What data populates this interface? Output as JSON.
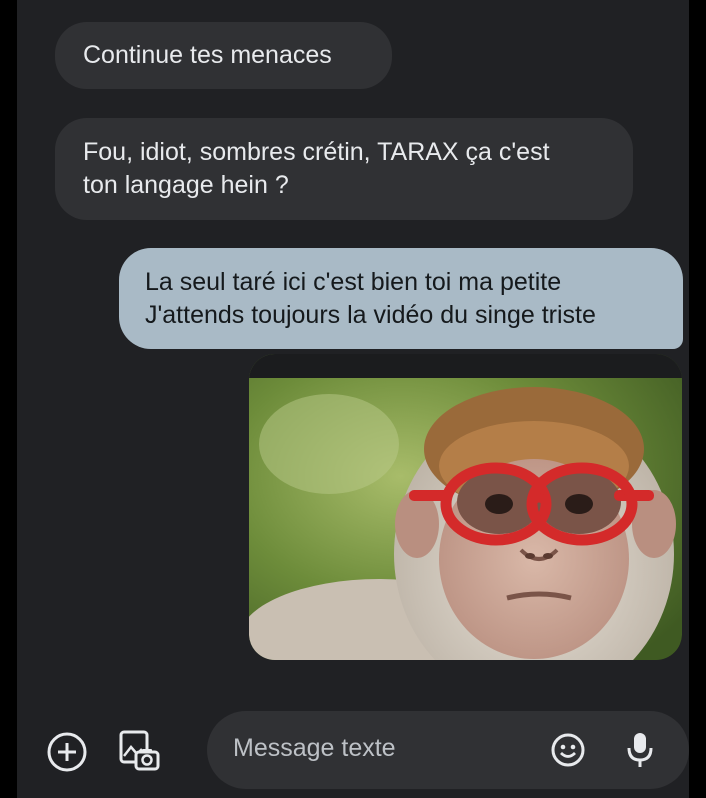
{
  "messages": [
    {
      "direction": "incoming",
      "text": "Continue tes menaces"
    },
    {
      "direction": "incoming",
      "text": "Fou, idiot, sombres crétin, TARAX  ça c'est\nton langage hein ?"
    },
    {
      "direction": "outgoing",
      "text": "La seul taré ici c'est bien toi ma petite\nJ'attends toujours la vidéo du singe triste"
    }
  ],
  "image_message": {
    "icon": "monkey-wearing-red-glasses-photo"
  },
  "composer": {
    "placeholder": "Message texte",
    "icons": [
      "add-circle-icon",
      "gallery-icon",
      "emoji-icon",
      "mic-icon"
    ]
  },
  "colors": {
    "background": "#202124",
    "incoming_bubble": "#303134",
    "outgoing_bubble": "#a9bac6",
    "text_light": "#e8eaed"
  }
}
